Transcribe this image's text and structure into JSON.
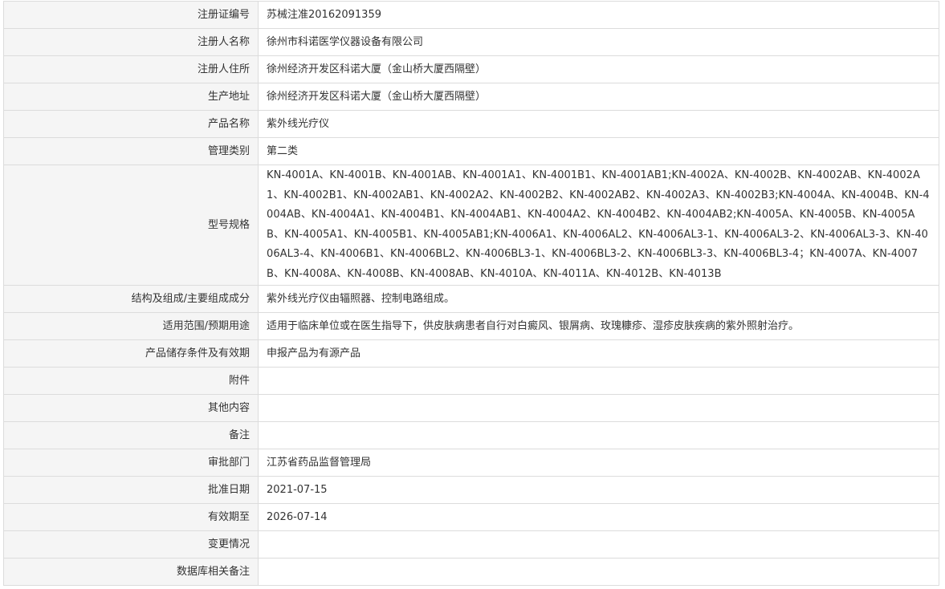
{
  "rows": [
    {
      "label": "注册证编号",
      "value": "苏械注准20162091359"
    },
    {
      "label": "注册人名称",
      "value": "徐州市科诺医学仪器设备有限公司"
    },
    {
      "label": "注册人住所",
      "value": "徐州经济开发区科诺大厦（金山桥大厦西隔壁）"
    },
    {
      "label": "生产地址",
      "value": "徐州经济开发区科诺大厦（金山桥大厦西隔壁）"
    },
    {
      "label": "产品名称",
      "value": "紫外线光疗仪"
    },
    {
      "label": "管理类别",
      "value": "第二类"
    },
    {
      "label": "型号规格",
      "value": "KN-4001A、KN-4001B、KN-4001AB、KN-4001A1、KN-4001B1、KN-4001AB1;KN-4002A、KN-4002B、KN-4002AB、KN-4002A1、KN-4002B1、KN-4002AB1、KN-4002A2、KN-4002B2、KN-4002AB2、KN-4002A3、KN-4002B3;KN-4004A、KN-4004B、KN-4004AB、KN-4004A1、KN-4004B1、KN-4004AB1、KN-4004A2、KN-4004B2、KN-4004AB2;KN-4005A、KN-4005B、KN-4005AB、KN-4005A1、KN-4005B1、KN-4005AB1;KN-4006A1、KN-4006AL2、KN-4006AL3-1、KN-4006AL3-2、KN-4006AL3-3、KN-4006AL3-4、KN-4006B1、KN-4006BL2、KN-4006BL3-1、KN-4006BL3-2、KN-4006BL3-3、KN-4006BL3-4；KN-4007A、KN-4007B、KN-4008A、KN-4008B、KN-4008AB、KN-4010A、KN-4011A、KN-4012B、KN-4013B"
    },
    {
      "label": "结构及组成/主要组成成分",
      "value": "紫外线光疗仪由辐照器、控制电路组成。"
    },
    {
      "label": "适用范围/预期用途",
      "value": "适用于临床单位或在医生指导下，供皮肤病患者自行对白癜风、银屑病、玫瑰糠疹、湿疹皮肤疾病的紫外照射治疗。"
    },
    {
      "label": "产品储存条件及有效期",
      "value": "申报产品为有源产品"
    },
    {
      "label": "附件",
      "value": ""
    },
    {
      "label": "其他内容",
      "value": ""
    },
    {
      "label": "备注",
      "value": ""
    },
    {
      "label": "审批部门",
      "value": "江苏省药品监督管理局"
    },
    {
      "label": "批准日期",
      "value": "2021-07-15"
    },
    {
      "label": "有效期至",
      "value": "2026-07-14"
    },
    {
      "label": "变更情况",
      "value": ""
    },
    {
      "label": "数据库相关备注",
      "value": ""
    }
  ]
}
